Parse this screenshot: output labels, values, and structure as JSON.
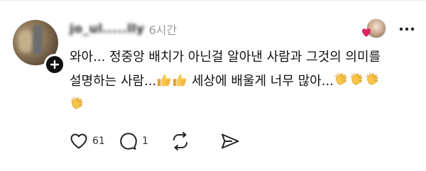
{
  "comment": {
    "username": "jo_ul.....lly",
    "time": "6시간",
    "text_line1": "와아... 정중앙 배치가 아닌걸 알아낸 사람과 그것의 의미를",
    "text_line2_a": "설명하는 사람...",
    "text_line2_b": " 세상에 배울게 너무 많아...",
    "emojis": [
      "thumbs-up",
      "clapping-hands"
    ]
  },
  "actions": {
    "like_count": "61",
    "reply_count": "1"
  },
  "colors": {
    "heart": "#e0245e",
    "emoji_yellow": "#f7c64a",
    "text": "#111111",
    "muted": "#999999"
  },
  "icons": {
    "follow": "plus-icon",
    "liked_by": "heart-icon",
    "more": "more-options-icon",
    "like": "heart-outline-icon",
    "reply": "comment-bubble-icon",
    "repost": "repost-icon",
    "share": "send-icon"
  }
}
